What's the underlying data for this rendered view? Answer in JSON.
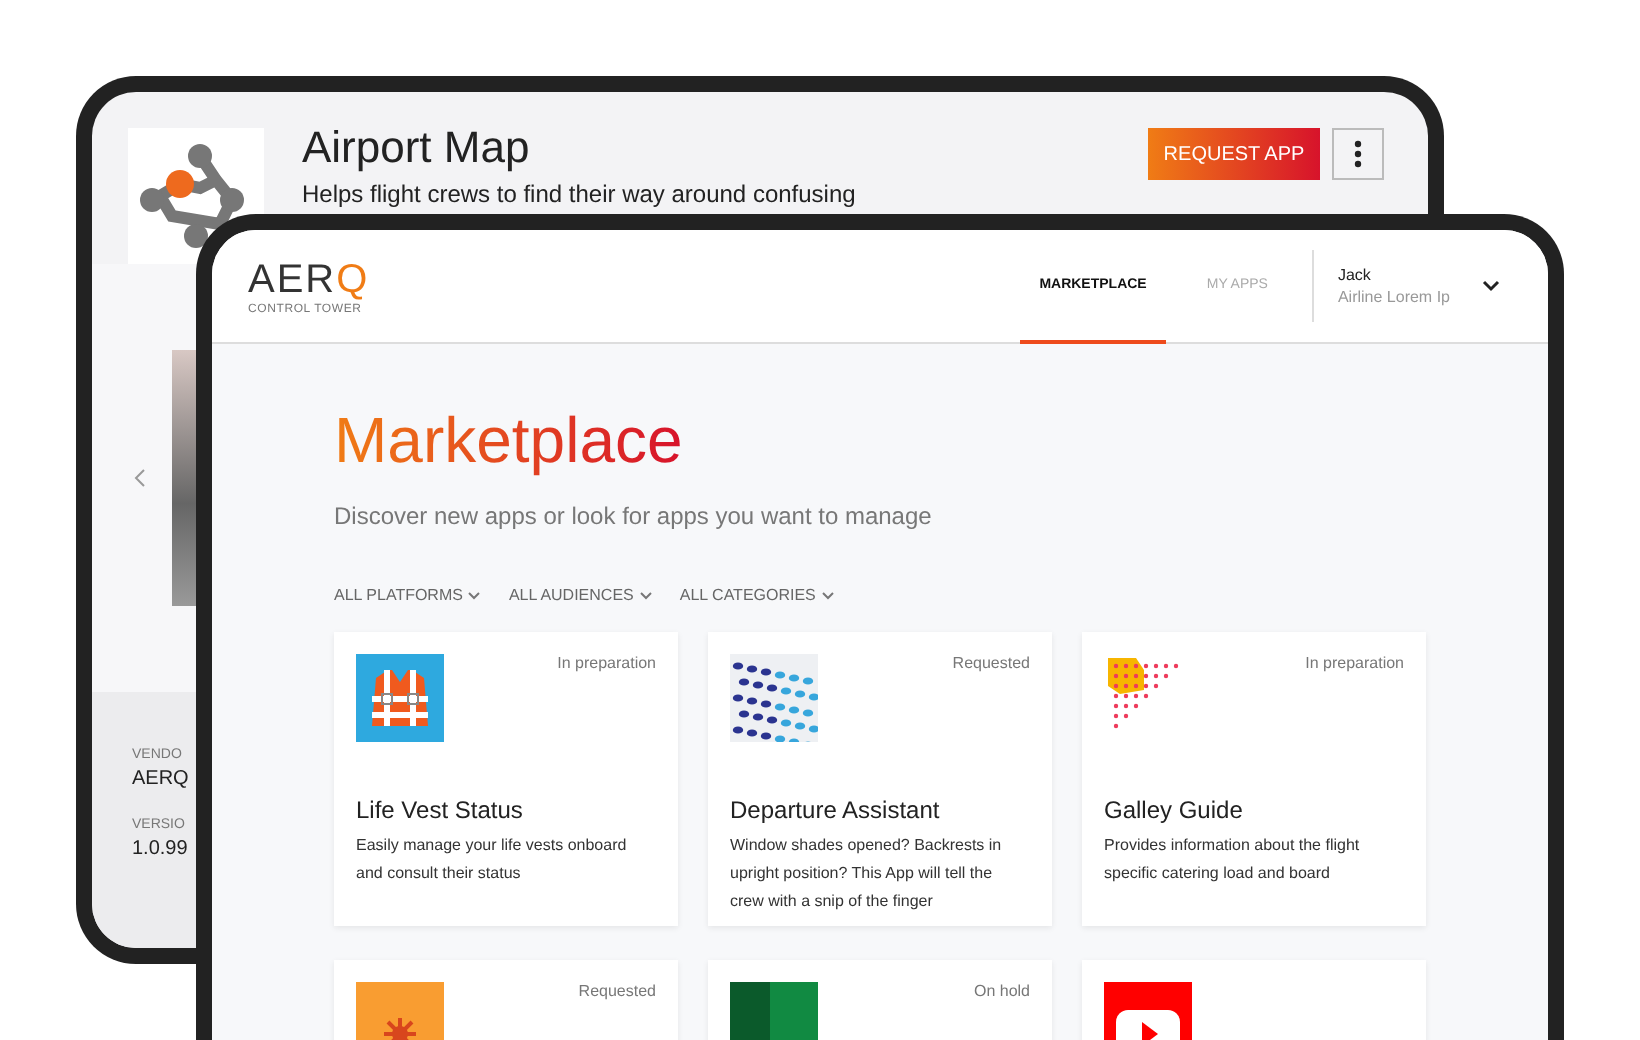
{
  "back_window": {
    "app": {
      "title": "Airport Map",
      "description": "Helps flight crews to find their way around confusing"
    },
    "request_button": "REQUEST APP",
    "details": [
      {
        "label": "VENDO",
        "value": "AERQ"
      },
      {
        "label": "VERSIO",
        "value": "1.0.99"
      }
    ]
  },
  "front_window": {
    "logo": {
      "wordmark": "AERQ",
      "subtitle": "CONTROL TOWER"
    },
    "nav": [
      {
        "label": "MARKETPLACE",
        "selected": true
      },
      {
        "label": "MY APPS",
        "selected": false
      }
    ],
    "user": {
      "name": "Jack",
      "organization": "Airline Lorem Ip"
    },
    "page": {
      "title": "Marketplace",
      "subtitle": "Discover new apps or look for apps you want to manage"
    },
    "filters": [
      "ALL PLATFORMS",
      "ALL AUDIENCES",
      "ALL CATEGORIES"
    ],
    "cards": [
      {
        "kind": "vest",
        "status": "In preparation",
        "title": "Life Vest Status",
        "description": "Easily manage your life vests onboard and consult their status"
      },
      {
        "kind": "dots",
        "status": "Requested",
        "title": "Departure Assistant",
        "description": "Window shades opened? Backrests in upright position? This App will tell the crew with a snip of the finger"
      },
      {
        "kind": "grid",
        "status": "In preparation",
        "title": "Galley Guide",
        "description": "Provides information about the flight specific catering load and board"
      },
      {
        "kind": "flower",
        "status": "Requested"
      },
      {
        "kind": "green",
        "status": "On hold"
      },
      {
        "kind": "play"
      }
    ]
  }
}
